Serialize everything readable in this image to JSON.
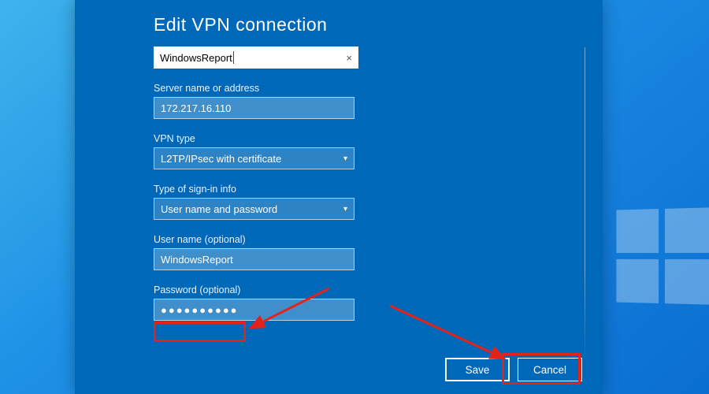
{
  "dialog": {
    "title": "Edit VPN connection",
    "connection_name": {
      "value": "WindowsReport",
      "clear_icon_label": "×"
    },
    "server": {
      "label": "Server name or address",
      "value": "172.217.16.110"
    },
    "vpn_type": {
      "label": "VPN type",
      "value": "L2TP/IPsec with certificate"
    },
    "signin_type": {
      "label": "Type of sign-in info",
      "value": "User name and password"
    },
    "username": {
      "label": "User name (optional)",
      "value": "WindowsReport"
    },
    "password": {
      "label": "Password (optional)",
      "value_masked": "●●●●●●●●●●"
    },
    "buttons": {
      "save": "Save",
      "cancel": "Cancel"
    }
  },
  "annotations": {
    "arrow_color": "#e2231a",
    "highlights": [
      "password-field",
      "save-button"
    ]
  }
}
